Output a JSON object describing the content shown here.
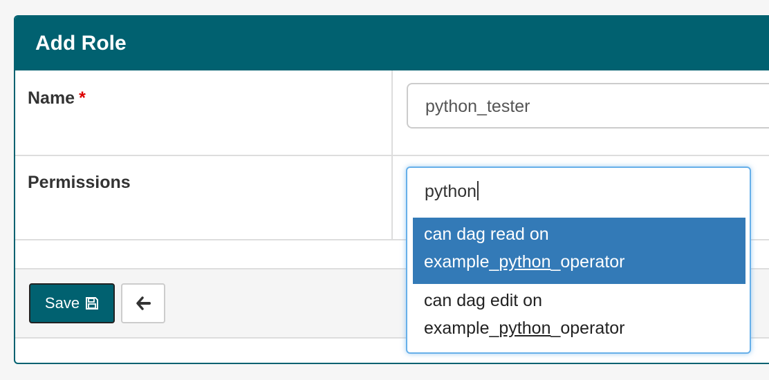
{
  "form": {
    "title": "Add Role",
    "name_label": "Name",
    "required_marker": "*",
    "name_value": "python_tester",
    "permissions_label": "Permissions",
    "permissions_search": "python"
  },
  "dropdown": {
    "options": [
      {
        "line1": "can dag read on",
        "prefix": "example_",
        "match": "python",
        "suffix": "_operator",
        "highlighted": true
      },
      {
        "line1": "can dag edit on",
        "prefix": "example_",
        "match": "python",
        "suffix": "_operator",
        "highlighted": false
      }
    ]
  },
  "footer": {
    "save_label": "Save"
  },
  "icons": {
    "save": "floppy-disk-icon",
    "back": "arrow-left-icon"
  },
  "colors": {
    "brand": "#016170",
    "highlight": "#337ab7",
    "required": "#dd0000",
    "focus_border": "#66afe9"
  }
}
